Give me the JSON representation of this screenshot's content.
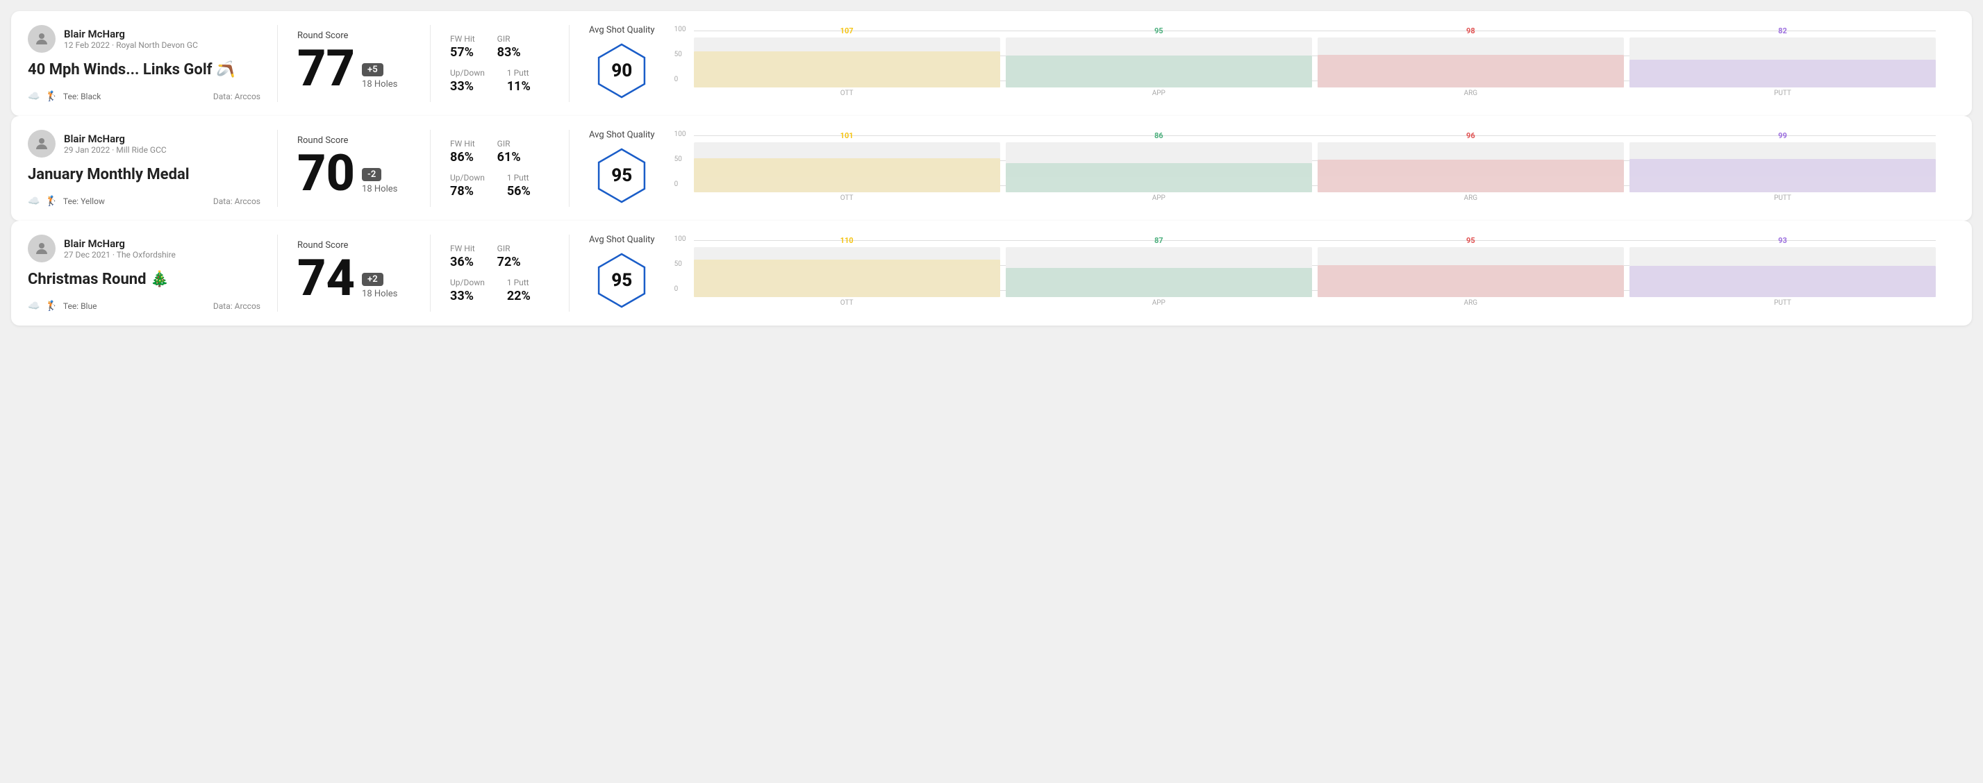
{
  "rounds": [
    {
      "id": "round1",
      "player_name": "Blair McHarg",
      "player_meta": "12 Feb 2022 · Royal North Devon GC",
      "title": "40 Mph Winds... Links Golf 🪃",
      "tee": "Black",
      "data_source": "Data: Arccos",
      "score": "77",
      "score_diff": "+5",
      "score_holes": "18 Holes",
      "fw_hit_label": "FW Hit",
      "fw_hit_value": "57%",
      "gir_label": "GIR",
      "gir_value": "83%",
      "updown_label": "Up/Down",
      "updown_value": "33%",
      "oneputt_label": "1 Putt",
      "oneputt_value": "11%",
      "avg_quality_label": "Avg Shot Quality",
      "quality_score": "90",
      "bars": [
        {
          "label": "OTT",
          "top_value": "107",
          "color": "#f5c518",
          "height_pct": 72,
          "marker_color": "#f5c518"
        },
        {
          "label": "APP",
          "top_value": "95",
          "color": "#4caf7d",
          "height_pct": 63,
          "marker_color": "#4caf7d"
        },
        {
          "label": "ARG",
          "top_value": "98",
          "color": "#e05252",
          "height_pct": 65,
          "marker_color": "#e05252"
        },
        {
          "label": "PUTT",
          "top_value": "82",
          "color": "#9c6fde",
          "height_pct": 55,
          "marker_color": "#9c6fde"
        }
      ]
    },
    {
      "id": "round2",
      "player_name": "Blair McHarg",
      "player_meta": "29 Jan 2022 · Mill Ride GCC",
      "title": "January Monthly Medal",
      "tee": "Yellow",
      "data_source": "Data: Arccos",
      "score": "70",
      "score_diff": "-2",
      "score_holes": "18 Holes",
      "fw_hit_label": "FW Hit",
      "fw_hit_value": "86%",
      "gir_label": "GIR",
      "gir_value": "61%",
      "updown_label": "Up/Down",
      "updown_value": "78%",
      "oneputt_label": "1 Putt",
      "oneputt_value": "56%",
      "avg_quality_label": "Avg Shot Quality",
      "quality_score": "95",
      "bars": [
        {
          "label": "OTT",
          "top_value": "101",
          "color": "#f5c518",
          "height_pct": 68,
          "marker_color": "#f5c518"
        },
        {
          "label": "APP",
          "top_value": "86",
          "color": "#4caf7d",
          "height_pct": 57,
          "marker_color": "#4caf7d"
        },
        {
          "label": "ARG",
          "top_value": "96",
          "color": "#e05252",
          "height_pct": 64,
          "marker_color": "#e05252"
        },
        {
          "label": "PUTT",
          "top_value": "99",
          "color": "#9c6fde",
          "height_pct": 66,
          "marker_color": "#9c6fde"
        }
      ]
    },
    {
      "id": "round3",
      "player_name": "Blair McHarg",
      "player_meta": "27 Dec 2021 · The Oxfordshire",
      "title": "Christmas Round 🎄",
      "tee": "Blue",
      "data_source": "Data: Arccos",
      "score": "74",
      "score_diff": "+2",
      "score_holes": "18 Holes",
      "fw_hit_label": "FW Hit",
      "fw_hit_value": "36%",
      "gir_label": "GIR",
      "gir_value": "72%",
      "updown_label": "Up/Down",
      "updown_value": "33%",
      "oneputt_label": "1 Putt",
      "oneputt_value": "22%",
      "avg_quality_label": "Avg Shot Quality",
      "quality_score": "95",
      "bars": [
        {
          "label": "OTT",
          "top_value": "110",
          "color": "#f5c518",
          "height_pct": 74,
          "marker_color": "#f5c518"
        },
        {
          "label": "APP",
          "top_value": "87",
          "color": "#4caf7d",
          "height_pct": 58,
          "marker_color": "#4caf7d"
        },
        {
          "label": "ARG",
          "top_value": "95",
          "color": "#e05252",
          "height_pct": 63,
          "marker_color": "#e05252"
        },
        {
          "label": "PUTT",
          "top_value": "93",
          "color": "#9c6fde",
          "height_pct": 62,
          "marker_color": "#9c6fde"
        }
      ]
    }
  ],
  "y_axis_labels": [
    "100",
    "50",
    "0"
  ],
  "round_score_label": "Round Score"
}
